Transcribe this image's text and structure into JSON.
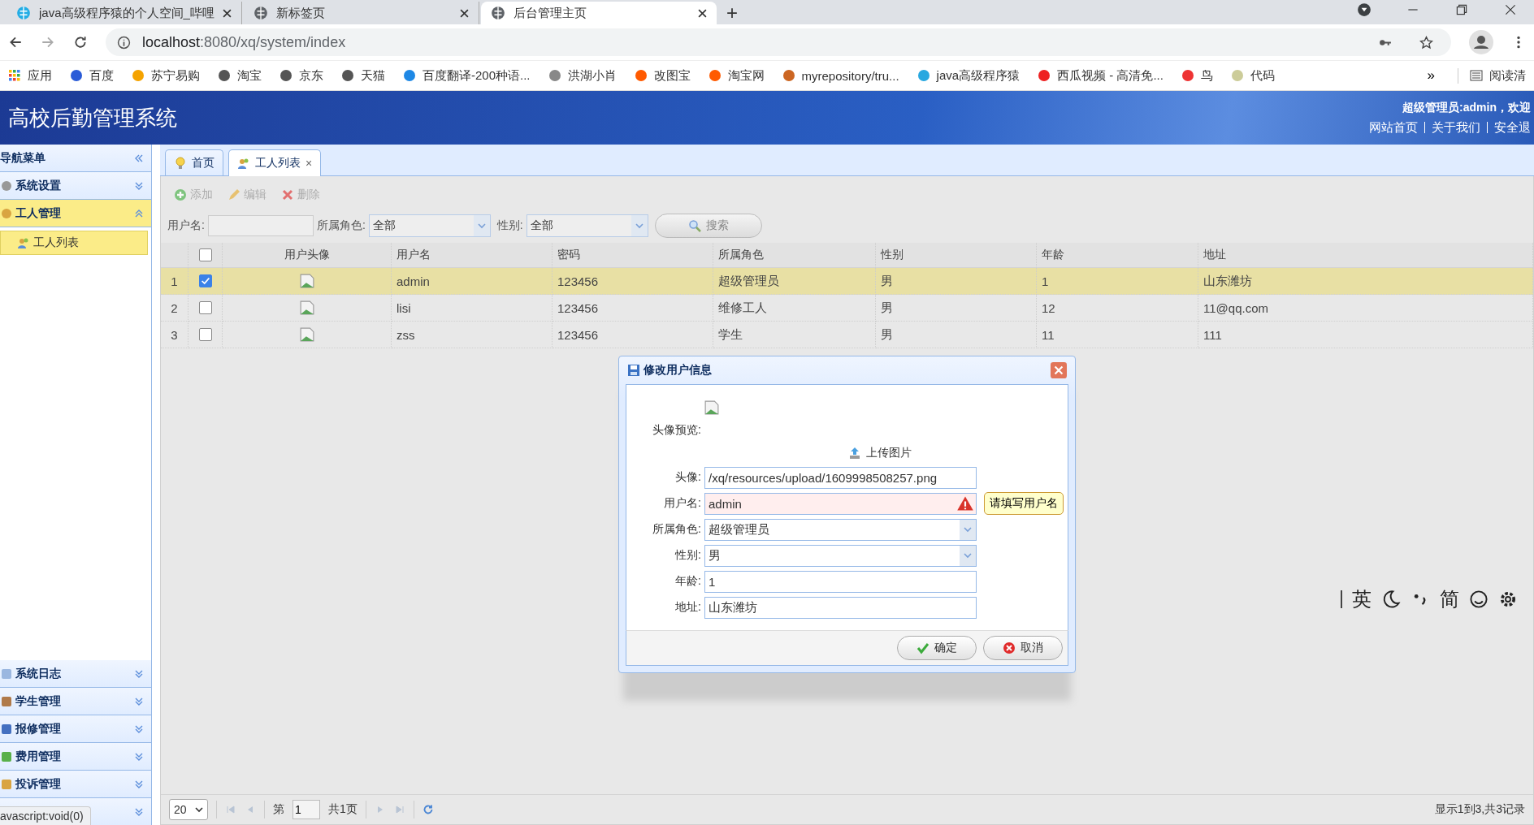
{
  "browser": {
    "tabs": [
      {
        "title": "java高级程序猿的个人空间_哔哩",
        "selected": false
      },
      {
        "title": "新标签页",
        "selected": false
      },
      {
        "title": "后台管理主页",
        "selected": true
      }
    ],
    "new_tab": "+",
    "url": {
      "host": "localhost",
      "path": ":8080/xq/system/index"
    },
    "bookmarks": [
      "应用",
      "百度",
      "苏宁易购",
      "淘宝",
      "京东",
      "天猫",
      "百度翻译-200种语...",
      "洪湖小肖",
      "改图宝",
      "淘宝网",
      "myrepository/tru...",
      "java高级程序猿",
      "西瓜视频 - 高清免...",
      "鸟",
      "代码"
    ],
    "bookmarks_more": "»",
    "reading_list": "阅读清"
  },
  "header": {
    "title": "高校后勤管理系统",
    "user": "超级管理员:admin，欢迎",
    "links": [
      "网站首页",
      "关于我们",
      "安全退"
    ]
  },
  "sidebar": {
    "title": "导航菜单",
    "groups": [
      {
        "label": "系统设置",
        "expanded": false
      },
      {
        "label": "工人管理",
        "expanded": true,
        "children": [
          {
            "label": "工人列表",
            "selected": true
          }
        ]
      }
    ],
    "bottom_groups": [
      {
        "label": "系统日志",
        "expanded": false
      },
      {
        "label": "学生管理",
        "expanded": false
      },
      {
        "label": "报修管理",
        "expanded": false
      },
      {
        "label": "费用管理",
        "expanded": false
      },
      {
        "label": "投诉管理",
        "expanded": false
      }
    ]
  },
  "content_tabs": [
    {
      "label": "首页",
      "selected": false,
      "closable": false
    },
    {
      "label": "工人列表",
      "selected": true,
      "closable": true
    }
  ],
  "tab_close": "×",
  "toolbar": [
    {
      "label": "添加",
      "disabled": true
    },
    {
      "label": "编辑",
      "disabled": true
    },
    {
      "label": "删除",
      "disabled": true
    }
  ],
  "filters": {
    "username_label": "用户名:",
    "role_label": "所属角色:",
    "role_value": "全部",
    "gender_label": "性别:",
    "gender_value": "全部",
    "search": "搜索"
  },
  "table": {
    "select_all_checked": false,
    "columns": [
      "用户头像",
      "用户名",
      "密码",
      "所属角色",
      "性别",
      "年龄",
      "地址"
    ],
    "rows": [
      {
        "number": "1",
        "checked": true,
        "selected": true,
        "username": "admin",
        "password": "123456",
        "role": "超级管理员",
        "gender": "男",
        "age": "1",
        "address": "山东潍坊"
      },
      {
        "number": "2",
        "checked": false,
        "selected": false,
        "username": "lisi",
        "password": "123456",
        "role": "维修工人",
        "gender": "男",
        "age": "12",
        "address": "11@qq.com"
      },
      {
        "number": "3",
        "checked": false,
        "selected": false,
        "username": "zss",
        "password": "123456",
        "role": "学生",
        "gender": "男",
        "age": "11",
        "address": "111"
      }
    ]
  },
  "pager": {
    "page_size": "20",
    "page_prefix": "第",
    "page": "1",
    "page_total": "共1页",
    "summary": "显示1到3,共3记录"
  },
  "dialog": {
    "title": "修改用户信息",
    "preview_label": "头像预览:",
    "upload": "上传图片",
    "fields": [
      {
        "label": "头像:",
        "value": "/xq/resources/upload/1609998508257.png",
        "kind": "text",
        "invalid": false
      },
      {
        "label": "用户名:",
        "value": "admin",
        "kind": "text",
        "invalid": true
      },
      {
        "label": "所属角色:",
        "value": "超级管理员",
        "kind": "select",
        "invalid": false
      },
      {
        "label": "性别:",
        "value": "男",
        "kind": "select",
        "invalid": false
      },
      {
        "label": "年龄:",
        "value": "1",
        "kind": "text",
        "invalid": false
      },
      {
        "label": "地址:",
        "value": "山东潍坊",
        "kind": "text",
        "invalid": false
      }
    ],
    "tooltip": "请填写用户名",
    "ok": "确定",
    "cancel": "取消"
  },
  "ime": {
    "language": "英",
    "script": "简"
  },
  "status": "avascript:void(0)"
}
